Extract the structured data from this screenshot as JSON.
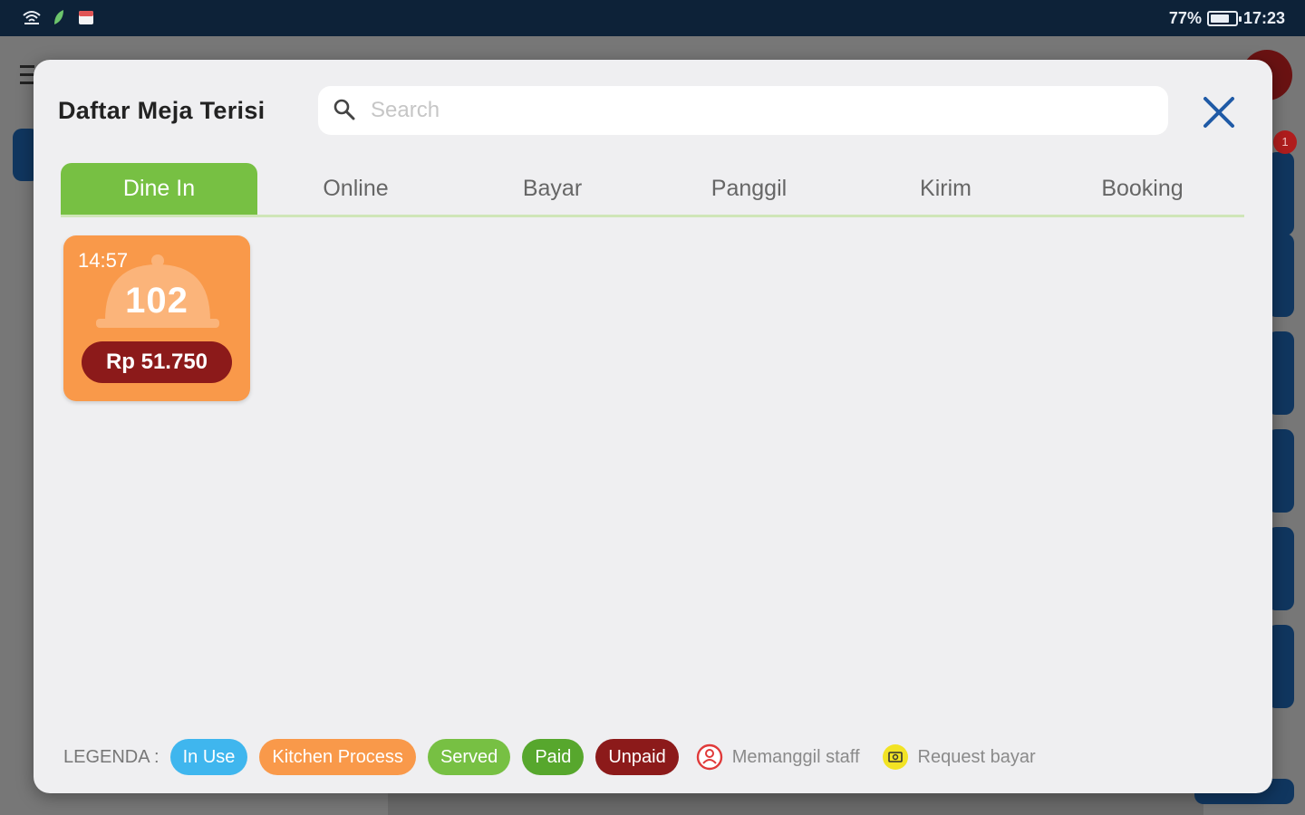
{
  "status_bar": {
    "battery_percent": "77%",
    "battery_level": 0.77,
    "time": "17:23",
    "icons": [
      "wifi-icon",
      "leaf-icon",
      "calendar-icon"
    ]
  },
  "background_app": {
    "notification_count": "1"
  },
  "modal": {
    "title": "Daftar Meja Terisi",
    "search": {
      "placeholder": "Search",
      "value": ""
    },
    "close_icon": "close-icon",
    "tabs": [
      {
        "label": "Dine In",
        "active": true
      },
      {
        "label": "Online",
        "active": false
      },
      {
        "label": "Bayar",
        "active": false
      },
      {
        "label": "Panggil",
        "active": false
      },
      {
        "label": "Kirim",
        "active": false
      },
      {
        "label": "Booking",
        "active": false
      }
    ],
    "tables": [
      {
        "time": "14:57",
        "number": "102",
        "price": "Rp 51.750",
        "status": "Kitchen Process"
      }
    ],
    "legend": {
      "label": "LEGENDA :",
      "statuses": [
        {
          "label": "In Use",
          "color": "#3fb6ee"
        },
        {
          "label": "Kitchen Process",
          "color": "#f9994a"
        },
        {
          "label": "Served",
          "color": "#77c043"
        },
        {
          "label": "Paid",
          "color": "#57a72d"
        },
        {
          "label": "Unpaid",
          "color": "#8c1a1a"
        }
      ],
      "call_staff": {
        "label": "Memanggil staff",
        "icon": "person-alert-icon"
      },
      "request_pay": {
        "label": "Request bayar",
        "icon": "cash-icon"
      }
    }
  },
  "colors": {
    "accent_green": "#77c043",
    "status_bar_bg": "#0d2238",
    "close_blue": "#1f5aa6"
  }
}
